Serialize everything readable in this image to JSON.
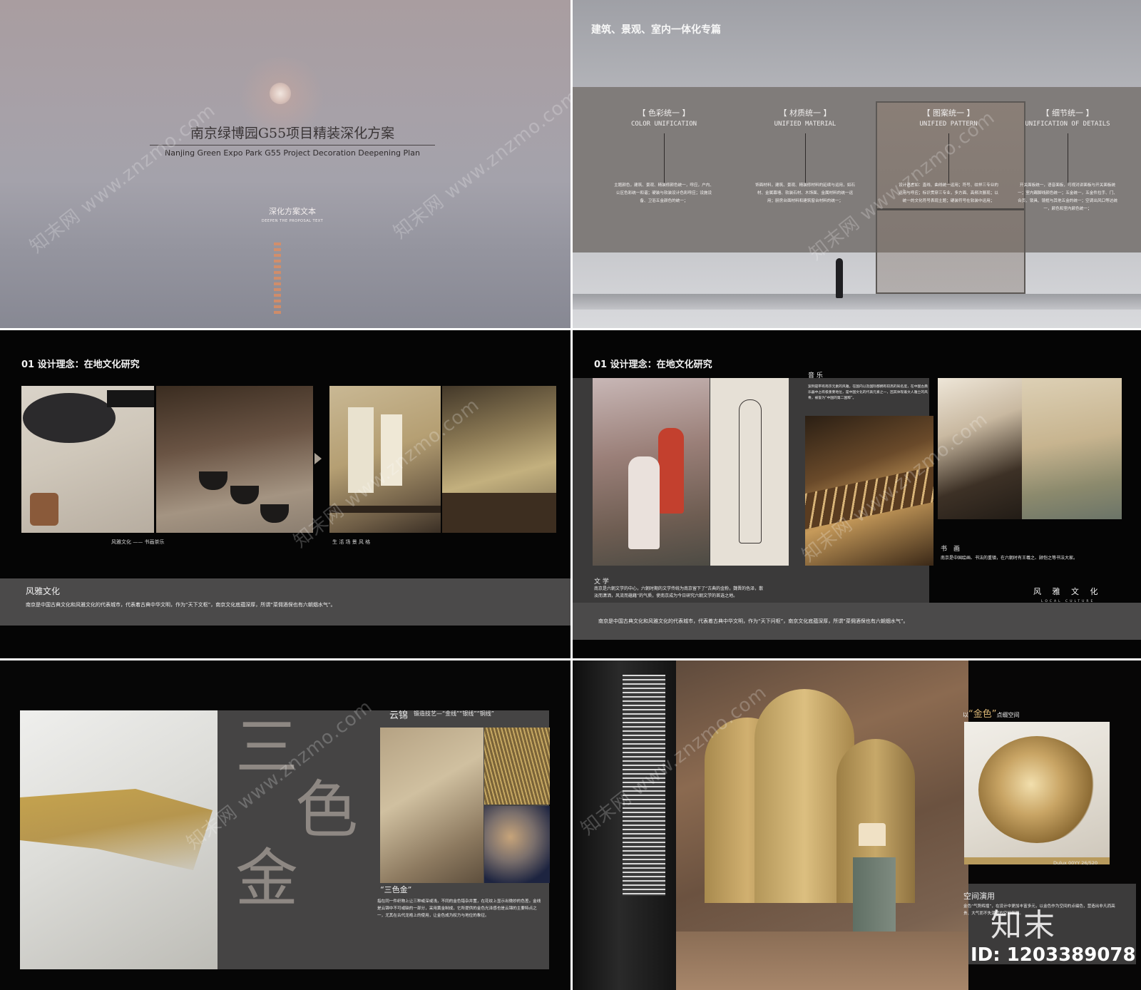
{
  "slide1": {
    "title": "南京绿博园G55项目精装深化方案",
    "subtitle_en": "Nanjing Green Expo Park G55 Project Decoration Deepening Plan",
    "doc_label": "深化方案文本",
    "doc_label_en": "DEEPEN THE PROPOSAL TEXT"
  },
  "slide2": {
    "heading": "建筑、景观、室内一体化专篇",
    "columns": [
      {
        "cn": "【 色彩统一 】",
        "en": "COLOR UNIFICATION",
        "body": "主题颜色，建筑、景观、精装修颜色统一，呼应，户内、公区色彩统一和谐；硬装与软装设计色彩呼应；设施设备、卫浴五金颜色的统一；"
      },
      {
        "cn": "【 材质统一 】",
        "en": "UNIFIED MATERIAL",
        "body": "饰面材料，建筑、景观、精装修材料的延续与运用，如石材、金属幕墙、软装石材、木饰面、金属材料的统一运用；厨房台面材料和建筑窗台材料的统一；"
      },
      {
        "cn": "【 图案统一 】",
        "en": "UNIFIED PATTERN",
        "body": "设计语言如：直线、曲线统一运用；符号、纹样三专业的运用与呼应；标识贯穿三专业，多方面、高频次展现；以统一的文化符号表现主题；硬装符号在软装中运用；"
      },
      {
        "cn": "【 细节统一 】",
        "en": "UNIFICATION OF DETAILS",
        "body": "开关面板统一，语音面板，可视对讲面板与开关面板统一；室内踢脚线颜色统一；五金统一，五金件拉手、门、合页、锁具、镜框与其他五金的统一；空调出风口等达统一，颜色和室内颜色统一；"
      }
    ]
  },
  "slide3": {
    "heading": "01 设计理念：在地文化研究",
    "caption_left": "风雅文化 —— 书画茶乐",
    "caption_right": "生 活 场 景 风 格",
    "band_title": "风雅文化",
    "band_text": "南京是中国古典文化和风雅文化的代表城市，代表着古典中华文明，作为“天下文枢”，南京文化底蕴深厚，所谓“菜佣酒保也有六朝烟水气”。"
  },
  "slide4": {
    "heading": "01 设计理念：在地文化研究",
    "music_title": "音 乐",
    "music_text": "案例是带有南京元素的风雅，在国内以及国际都拥有较高的知名度，在中国古典乐器中占有极重要地位，是中国文化的代表元素之一，因其体现着文人雅士的风骨，被誉为“中国的第二国粹”。",
    "painting_title": "书　画",
    "painting_text": "南京是中国绘画、书法的重镇，在六朝时有王羲之、顾恺之等书法大家。",
    "lit_title": "文 学",
    "lit_text": "南京是六朝文学的中心，六朝时期的文学传统为南京留下了“古典的金粉，魏晋的色泽，散淡而潇洒，风流而蕴藉”的气质，使南京成为今日研究六朝文学的首选之地。",
    "local_cn": "风 雅 文 化",
    "local_en": "LOCAL CULTURE",
    "band_text": "南京是中国古典文化和风雅文化的代表城市，代表着古典中华文明，作为“天下问枢”，南京文化底蕴深厚，所谓“菜佣酒保也有六朝烟水气”。"
  },
  "slide5": {
    "big1": "三",
    "big2": "色",
    "big3": "金",
    "yun": "云锦",
    "yun_sub": "锻造技艺—“金线”“银线”“铜线”",
    "sanse": "“三色金”",
    "desc": "指在同一件织物上让三种或深或浅，不同的金色错杂并置，在花纹上显示出微妙的色差。金线是云锦中不可或缺的一部分，采用黄金制成，它所提供的金色光泽感也是云锦的主要特点之一，尤其在古代龙袍上的使用，让金色成为权力与地位的象征。"
  },
  "slide6": {
    "t1_pre": "以",
    "t1_gold": "“金色”",
    "t1_post": "点缀空间",
    "dulux": "Dulux 00YY 26/520",
    "kj": "空间演用",
    "kj_text": "金色“气势辉煌”，在设计中更加丰富多元，以金色作为空间的点缀色，营造出非凡而高贵、大气而不失温度的空间氛围。",
    "zm": "知末",
    "id": "ID: 1203389078"
  },
  "watermark": "知末网 www.znzmo.com",
  "colors": {
    "accent_gold": "#d9b574",
    "gray_band": "#4b4a4a",
    "black": "#050505"
  }
}
